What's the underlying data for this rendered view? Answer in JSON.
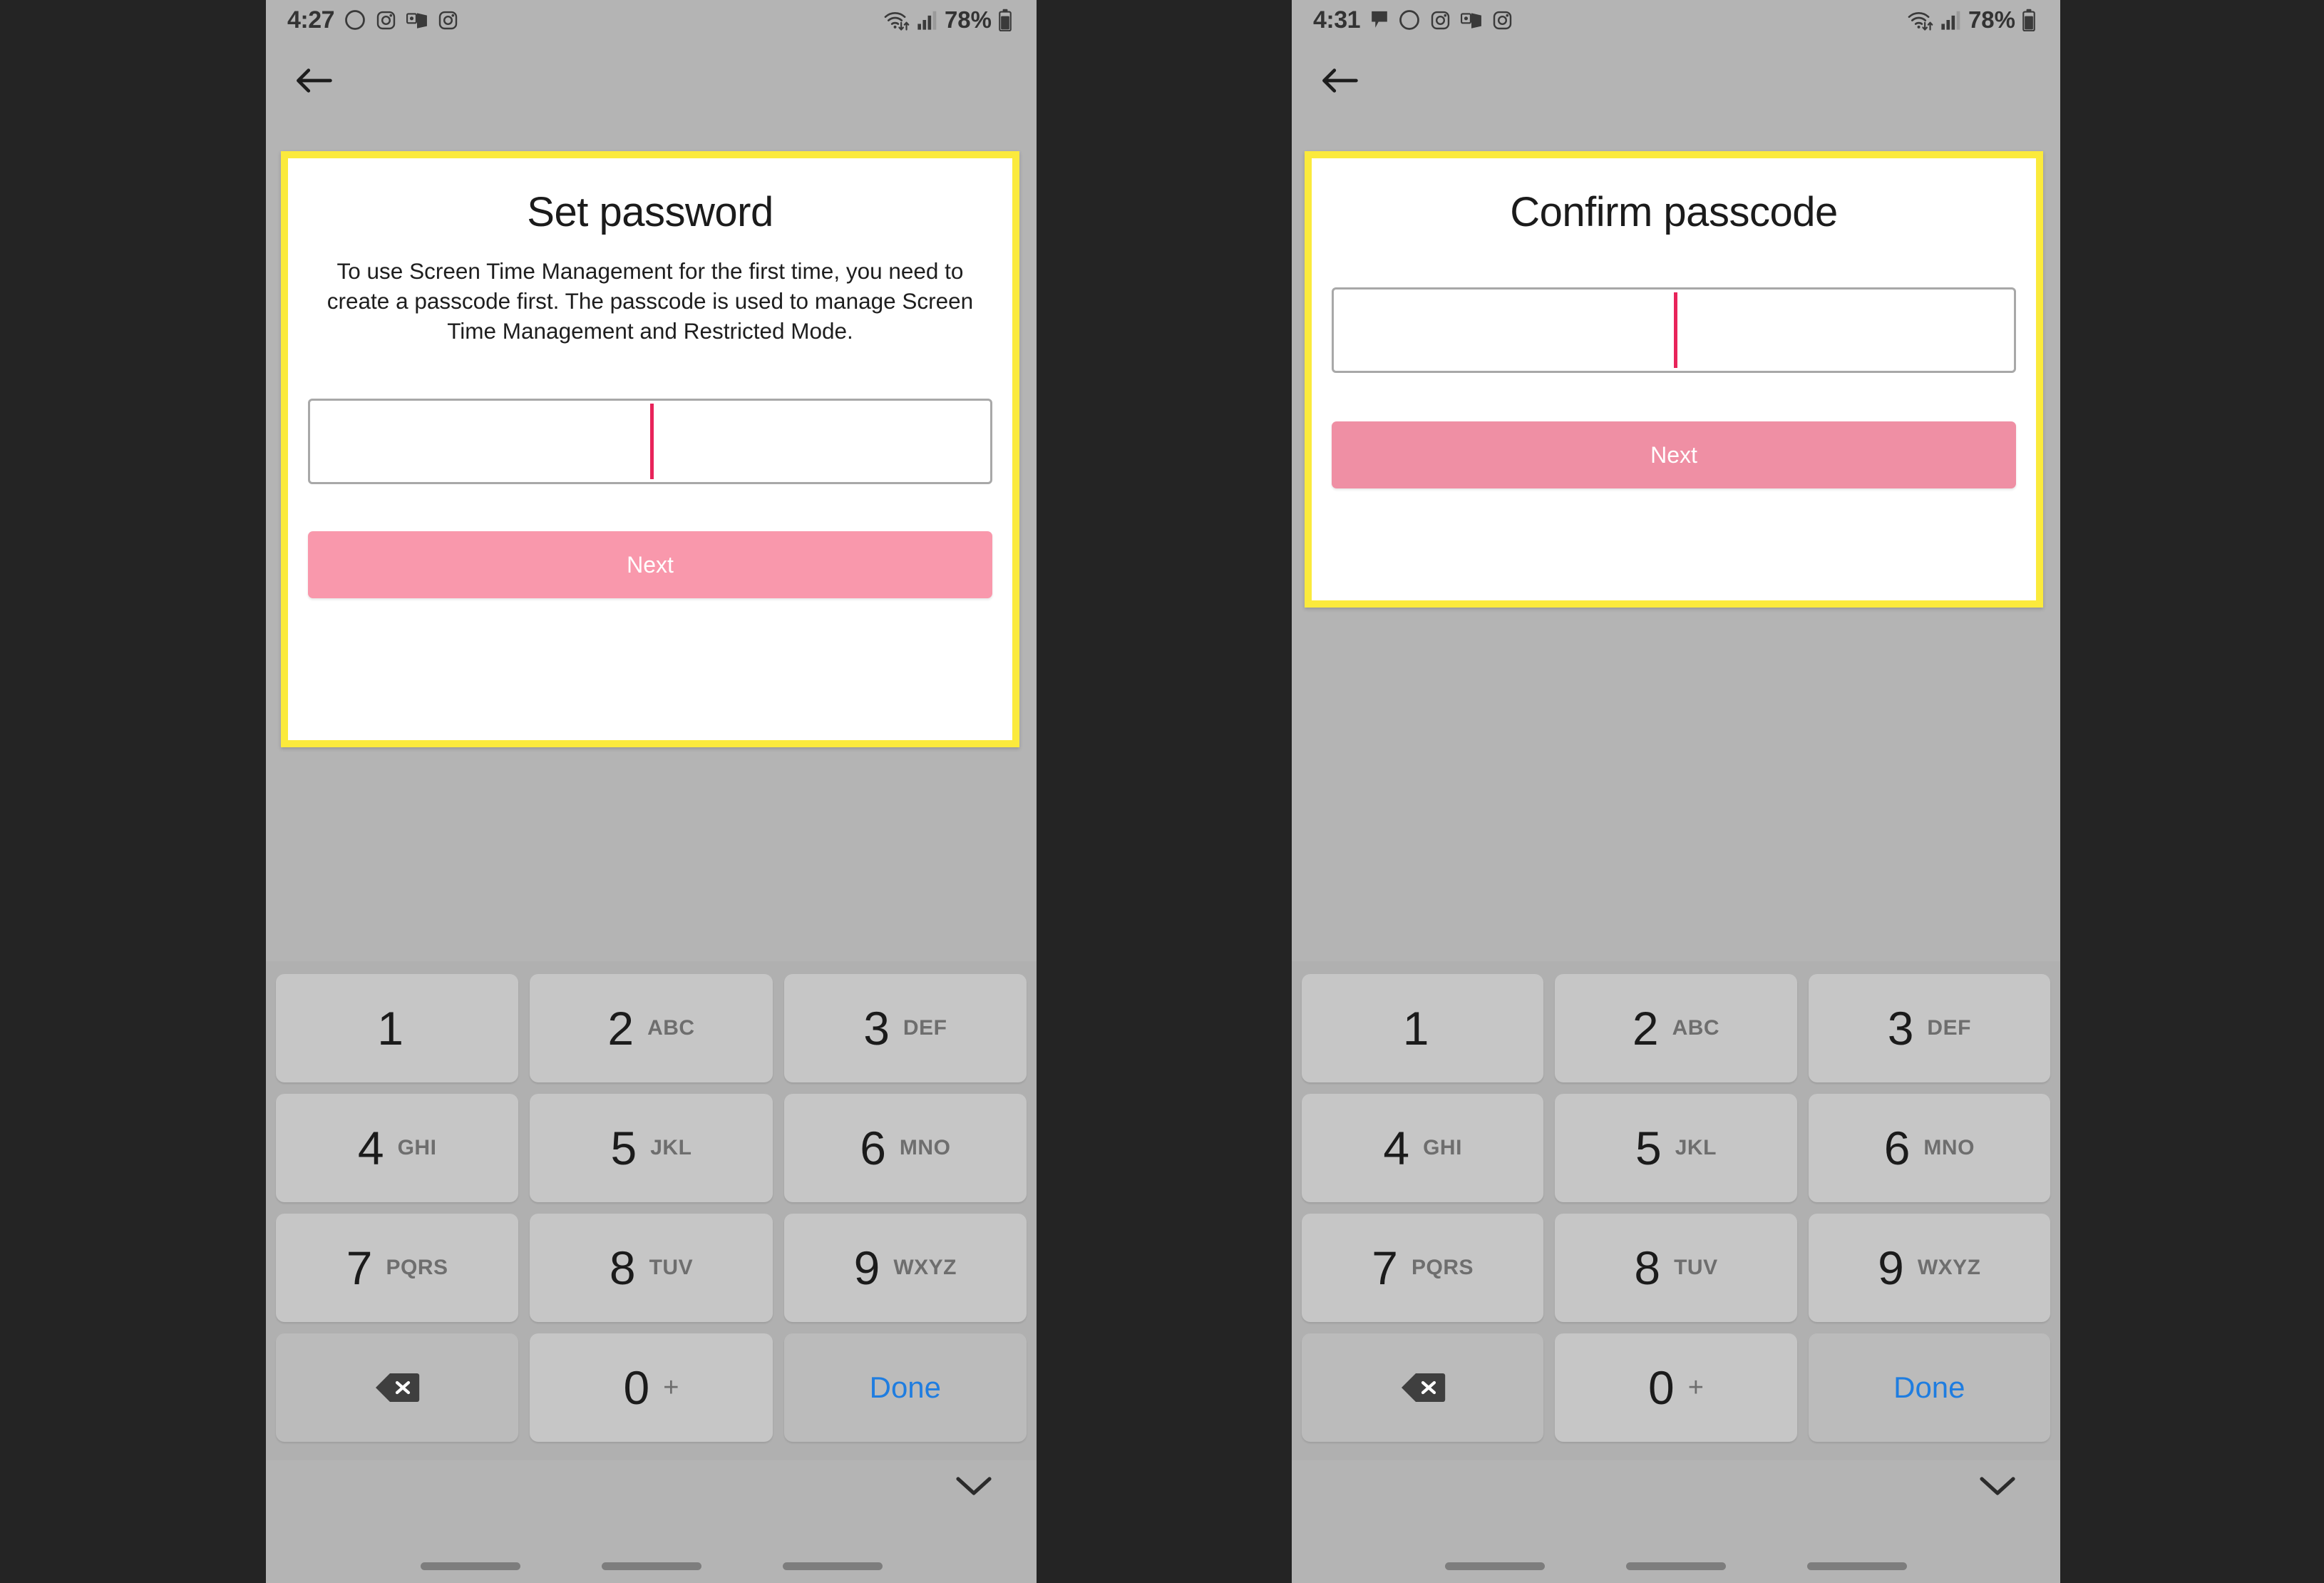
{
  "canvas": {
    "background": "#242424"
  },
  "theme": {
    "screen_bg": "#b4b4b4",
    "card_border": "#fbea3c",
    "card_bg": "#ffffff",
    "next_bg_left": "#f998ac",
    "next_bg_right": "#ef8fa4",
    "caret": "#e8245a",
    "keypad_bg": "#b0b0b0",
    "key_bg": "#c6c6c6",
    "fnkey_bg": "#bbbbbb",
    "done_color": "#1f7de0"
  },
  "phones": [
    {
      "id": "phone-left",
      "status_bar": {
        "time": "4:27",
        "left_icons": [
          "circle-outline-icon",
          "instagram-icon",
          "outlook-icon",
          "instagram-icon"
        ],
        "wifi_icon": "wifi-updown-icon",
        "signal_icon": "signal-bars-icon",
        "battery_percent": "78%",
        "battery_icon": "battery-icon"
      },
      "back_button": {
        "icon": "arrow-left-icon",
        "label": "Back"
      },
      "card": {
        "title": "Set password",
        "description": "To use Screen Time Management for the first time, you need to create a passcode first. The passcode is used to manage Screen Time Management and Restricted Mode.",
        "passcode_field": {
          "value": "",
          "placeholder": ""
        },
        "next_label": "Next"
      },
      "keypad": {
        "rows": [
          [
            {
              "num": "1",
              "sub": ""
            },
            {
              "num": "2",
              "sub": "ABC"
            },
            {
              "num": "3",
              "sub": "DEF"
            }
          ],
          [
            {
              "num": "4",
              "sub": "GHI"
            },
            {
              "num": "5",
              "sub": "JKL"
            },
            {
              "num": "6",
              "sub": "MNO"
            }
          ],
          [
            {
              "num": "7",
              "sub": "PQRS"
            },
            {
              "num": "8",
              "sub": "TUV"
            },
            {
              "num": "9",
              "sub": "WXYZ"
            }
          ]
        ],
        "backspace_icon": "backspace-icon",
        "zero": {
          "num": "0",
          "sub": "+"
        },
        "done_label": "Done"
      },
      "nav": {
        "chevron_icon": "chevron-down-icon",
        "pills": 3
      }
    },
    {
      "id": "phone-right",
      "status_bar": {
        "time": "4:31",
        "left_icons": [
          "chat-bubble-icon",
          "circle-outline-icon",
          "instagram-icon",
          "outlook-icon",
          "instagram-icon"
        ],
        "wifi_icon": "wifi-updown-icon",
        "signal_icon": "signal-bars-icon",
        "battery_percent": "78%",
        "battery_icon": "battery-icon"
      },
      "back_button": {
        "icon": "arrow-left-icon",
        "label": "Back"
      },
      "card": {
        "title": "Confirm passcode",
        "description": "",
        "passcode_field": {
          "value": "",
          "placeholder": ""
        },
        "next_label": "Next"
      },
      "keypad": {
        "rows": [
          [
            {
              "num": "1",
              "sub": ""
            },
            {
              "num": "2",
              "sub": "ABC"
            },
            {
              "num": "3",
              "sub": "DEF"
            }
          ],
          [
            {
              "num": "4",
              "sub": "GHI"
            },
            {
              "num": "5",
              "sub": "JKL"
            },
            {
              "num": "6",
              "sub": "MNO"
            }
          ],
          [
            {
              "num": "7",
              "sub": "PQRS"
            },
            {
              "num": "8",
              "sub": "TUV"
            },
            {
              "num": "9",
              "sub": "WXYZ"
            }
          ]
        ],
        "backspace_icon": "backspace-icon",
        "zero": {
          "num": "0",
          "sub": "+"
        },
        "done_label": "Done"
      },
      "nav": {
        "chevron_icon": "chevron-down-icon",
        "pills": 3
      }
    }
  ]
}
